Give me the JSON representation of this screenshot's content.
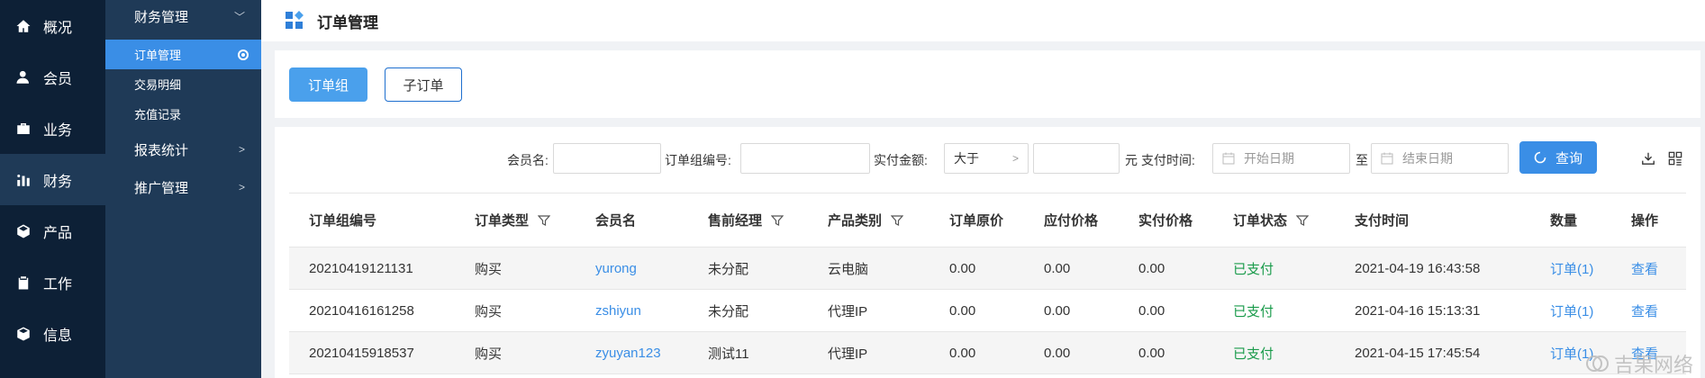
{
  "nav_primary": [
    {
      "label": "概况",
      "icon": "home-icon"
    },
    {
      "label": "会员",
      "icon": "user-icon"
    },
    {
      "label": "业务",
      "icon": "briefcase-icon"
    },
    {
      "label": "财务",
      "icon": "chart-icon",
      "active": true
    },
    {
      "label": "产品",
      "icon": "cube-icon"
    },
    {
      "label": "工作",
      "icon": "clipboard-icon"
    },
    {
      "label": "信息",
      "icon": "box-icon"
    }
  ],
  "nav_secondary": {
    "finance_group": "财务管理",
    "sub_items": [
      "订单管理",
      "交易明细",
      "充值记录"
    ],
    "reports_group": "报表统计",
    "promo_group": "推广管理"
  },
  "page": {
    "title": "订单管理"
  },
  "tabs": [
    "订单组",
    "子订单"
  ],
  "filters": {
    "member_label": "会员名:",
    "order_group_no_label": "订单组编号:",
    "paid_amount_label": "实付金额:",
    "compare_value": "大于",
    "unit_label": "元",
    "pay_time_label": "支付时间:",
    "start_date_placeholder": "开始日期",
    "to_label": "至",
    "end_date_placeholder": "结束日期",
    "query_button": "查询"
  },
  "table": {
    "columns": [
      "订单组编号",
      "订单类型",
      "会员名",
      "售前经理",
      "产品类别",
      "订单原价",
      "应付价格",
      "实付价格",
      "订单状态",
      "支付时间",
      "数量",
      "操作"
    ],
    "rows": [
      {
        "no": "20210419121131",
        "type": "购买",
        "member": "yurong",
        "manager": "未分配",
        "category": "云电脑",
        "orig": "0.00",
        "due": "0.00",
        "paid": "0.00",
        "status": "已支付",
        "time": "2021-04-19 16:43:58",
        "qty": "订单(1)",
        "op": "查看"
      },
      {
        "no": "20210416161258",
        "type": "购买",
        "member": "zshiyun",
        "manager": "未分配",
        "category": "代理IP",
        "orig": "0.00",
        "due": "0.00",
        "paid": "0.00",
        "status": "已支付",
        "time": "2021-04-16 15:13:31",
        "qty": "订单(1)",
        "op": "查看"
      },
      {
        "no": "20210415918537",
        "type": "购买",
        "member": "zyuyan123",
        "manager": "测试11",
        "category": "代理IP",
        "orig": "0.00",
        "due": "0.00",
        "paid": "0.00",
        "status": "已支付",
        "time": "2021-04-15 17:45:54",
        "qty": "订单(1)",
        "op": "查看"
      }
    ]
  },
  "watermark": {
    "text": "吉果网络"
  },
  "colors": {
    "sidebar": "#0d2036",
    "submenu": "#1f3a57",
    "accent": "#3a8ee6",
    "paid": "#1a9b4b"
  }
}
